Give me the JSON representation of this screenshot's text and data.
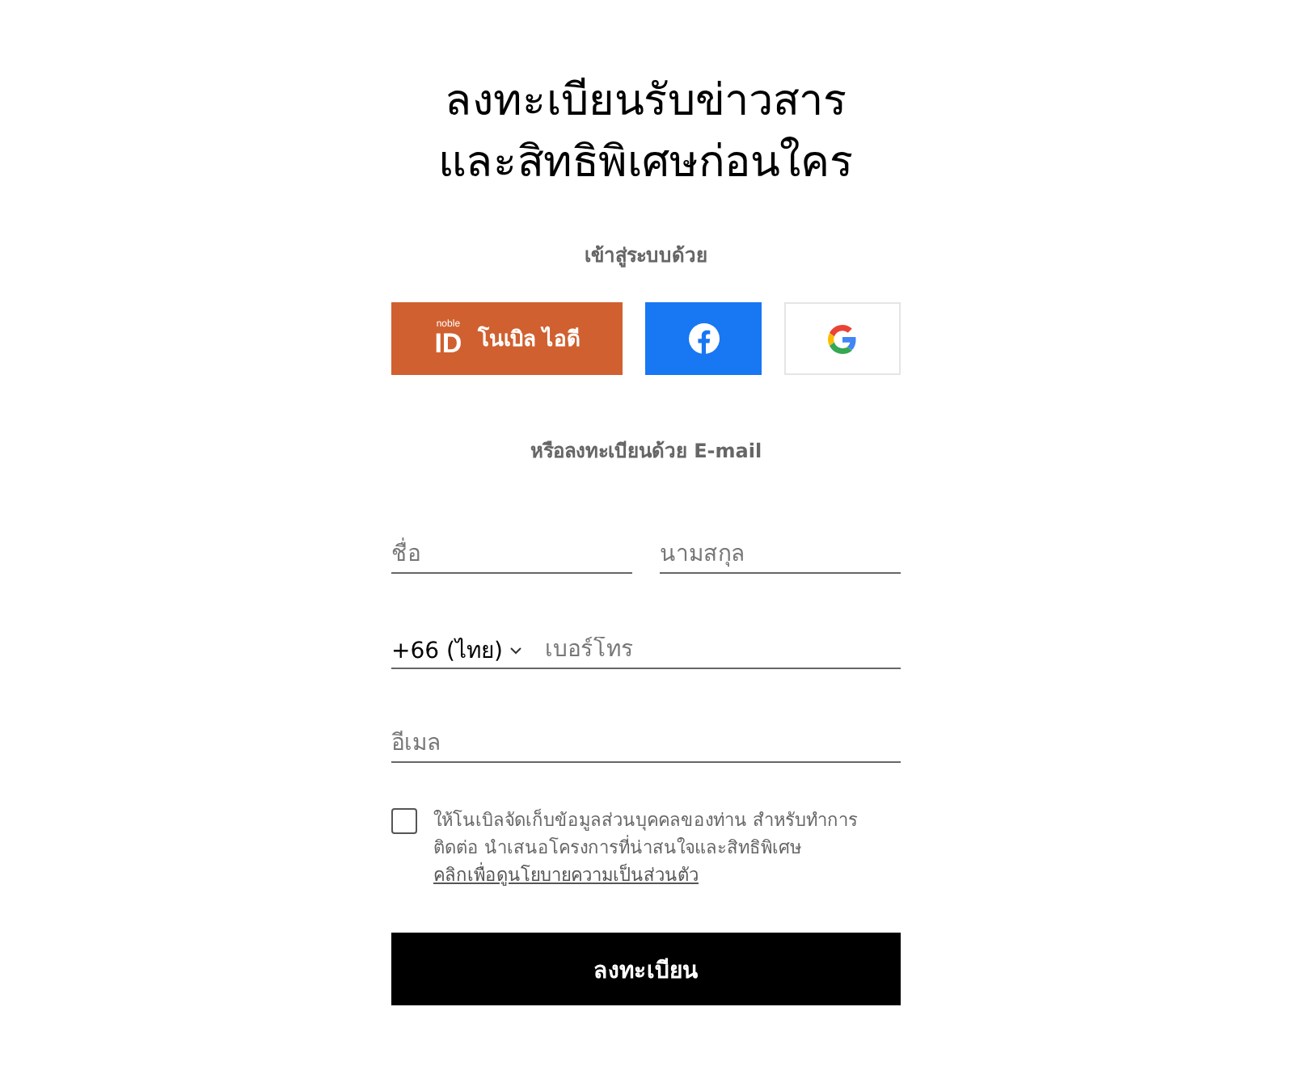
{
  "title_lines": [
    "ลงทะเบียนรับข่าวสาร",
    "และสิทธิพิเศษก่อนใคร"
  ],
  "login_label": "เข้าสู่ระบบด้วย",
  "social_buttons": [
    {
      "kind": "noble",
      "logo_small": "noble",
      "logo_big": "ID",
      "label": "โนเบิล ไอดี"
    },
    {
      "kind": "facebook"
    },
    {
      "kind": "google"
    }
  ],
  "or_label": "หรือลงทะเบียนด้วย E-mail",
  "fields": {
    "first_name": {
      "placeholder": "ชื่อ"
    },
    "last_name": {
      "placeholder": "นามสกุล"
    },
    "country_code": "+66 (ไทย)",
    "phone": {
      "placeholder": "เบอร์โทร"
    },
    "email": {
      "placeholder": "อีเมล"
    }
  },
  "consent": {
    "checked": false,
    "text": "ให้โนเบิลจัดเก็บข้อมูลส่วนบุคคลของท่าน สำหรับทำการติดต่อ นำเสนอโครงการที่น่าสนใจและสิทธิพิเศษ",
    "link": "คลิกเพื่อดูนโยบายความเป็นส่วนตัว"
  },
  "submit": "ลงทะเบียน"
}
